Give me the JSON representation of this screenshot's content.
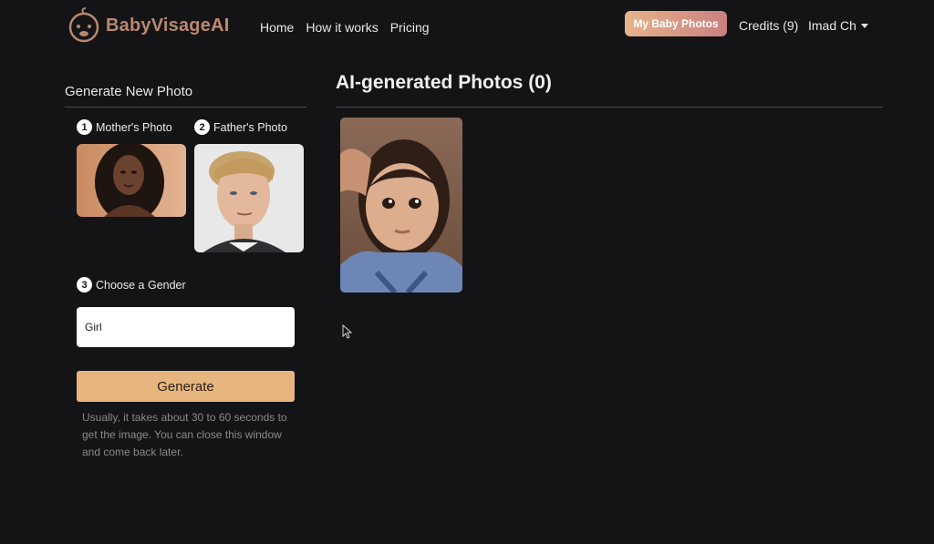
{
  "nav": {
    "logo_parts": [
      "Baby",
      "Visage",
      "AI"
    ],
    "links": [
      "Home",
      "How it works",
      "Pricing"
    ],
    "my_photos_label": "My Baby Photos",
    "credits_label": "Credits (9)",
    "user_name": "Imad Ch"
  },
  "generator": {
    "title": "Generate New Photo",
    "mother_label": "Mother's Photo",
    "father_label": "Father's Photo",
    "gender_label": "Choose a Gender",
    "gender_value": "Girl",
    "generate_label": "Generate",
    "hint": "Usually, it takes about 30 to 60 seconds to get the image. You can close this window and come back later."
  },
  "steps": [
    "1",
    "2",
    "3"
  ],
  "results": {
    "title": "AI-generated Photos (0)"
  },
  "colors": {
    "background": "#141416",
    "accent": "#e7b57e",
    "brand": "#c6876f"
  }
}
